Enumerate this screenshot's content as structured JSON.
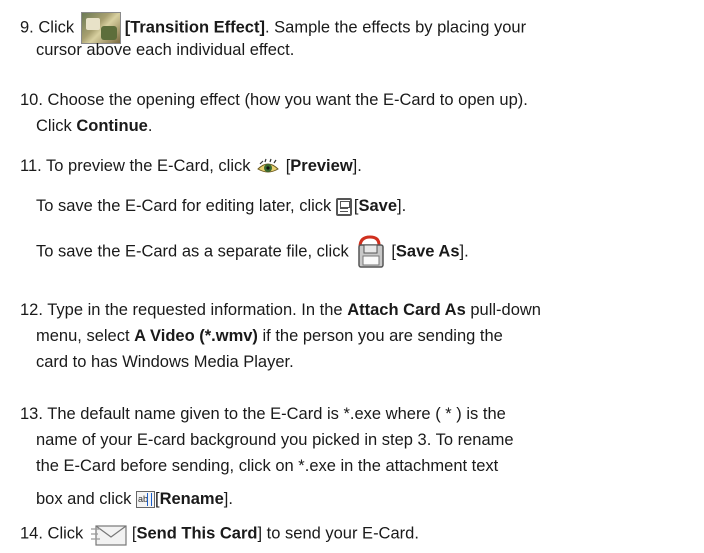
{
  "steps": {
    "s9": {
      "num": "9.",
      "click": "Click",
      "label": "[Transition Effect]",
      "rest": ". Sample the effects by placing your",
      "line2": "cursor above each individual effect."
    },
    "s10": {
      "num": "10.",
      "line1": "Choose the opening effect (how you want the E-Card to open up).",
      "click": "Click",
      "continue": "Continue",
      "period": "."
    },
    "s11": {
      "num": "11.",
      "preview_pre": "To preview the E-Card, click",
      "preview_label": "Preview",
      "save_pre": "To save the E-Card for editing later, click",
      "save_label": "Save",
      "saveas_pre": "To save the E-Card as a separate file, click",
      "saveas_label": "Save As"
    },
    "s12": {
      "num": "12.",
      "line1_pre": "Type in the requested information.  In the",
      "attach": "Attach Card As",
      "line1_post": "pull-down",
      "line2_pre": "menu, select",
      "video": "A Video (*.wmv)",
      "line2_post": "if the person you are sending the",
      "line3": "card to has Windows Media Player."
    },
    "s13": {
      "num": "13.",
      "line1": "The default name given to the E-Card is *.exe where ( * ) is the",
      "line2": "name of your E-card background you picked in step 3.  To rename",
      "line3": "the E-Card before sending, click on *.exe in the attachment text",
      "line4_pre": "box and click",
      "rename_label": "Rename"
    },
    "s14": {
      "num": "14.",
      "click": "Click",
      "send_label": "Send This Card",
      "post": "] to send your E-Card."
    }
  },
  "icons": [
    "transition-icon",
    "preview-eye-icon",
    "save-floppy-icon",
    "save-as-floppy-icon",
    "rename-text-icon",
    "send-envelope-icon"
  ]
}
